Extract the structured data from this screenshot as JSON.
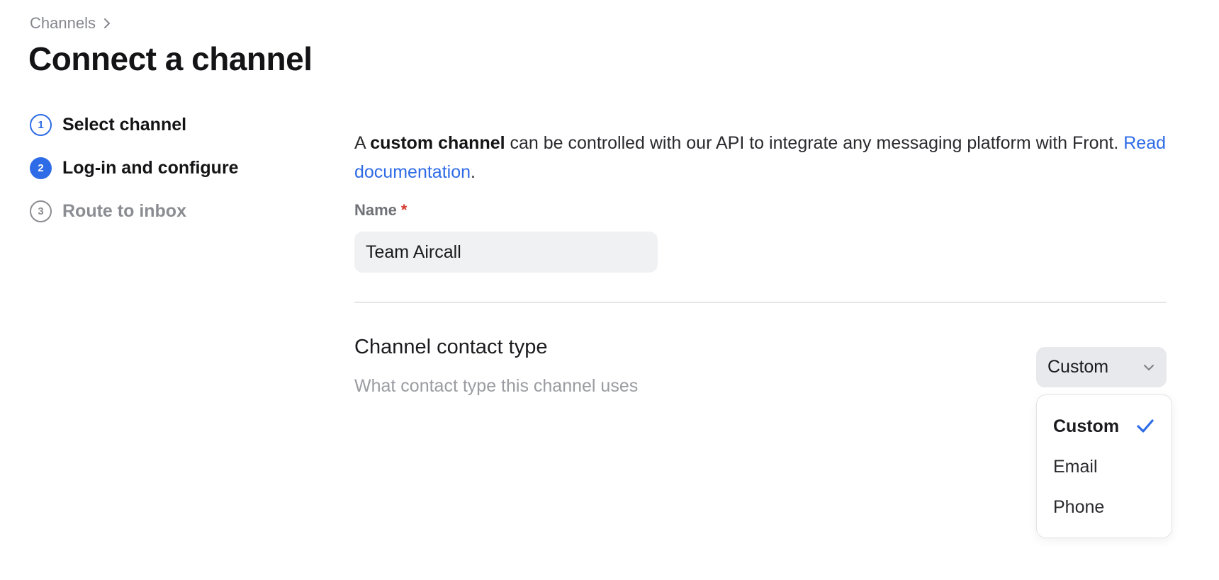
{
  "breadcrumb": {
    "parent_label": "Channels",
    "separator_icon": "chevron-right-icon"
  },
  "page_title": "Connect a channel",
  "steps": [
    {
      "number": "1",
      "label": "Select channel",
      "state": "done"
    },
    {
      "number": "2",
      "label": "Log-in and configure",
      "state": "active"
    },
    {
      "number": "3",
      "label": "Route to inbox",
      "state": "pending"
    }
  ],
  "description": {
    "prefix": "A ",
    "bold": "custom channel",
    "middle": " can be controlled with our API to integrate any messaging platform with Front. ",
    "link": "Read documentation",
    "suffix": "."
  },
  "name_field": {
    "label": "Name",
    "required_marker": "*",
    "value": "Team Aircall"
  },
  "contact_type": {
    "title": "Channel contact type",
    "description": "What contact type this channel uses",
    "selected": "Custom",
    "options": [
      {
        "label": "Custom",
        "selected": true
      },
      {
        "label": "Email",
        "selected": false
      },
      {
        "label": "Phone",
        "selected": false
      }
    ]
  },
  "colors": {
    "accent": "#2e6be6",
    "required": "#d33a2c",
    "muted_text": "#9a9ca1"
  }
}
